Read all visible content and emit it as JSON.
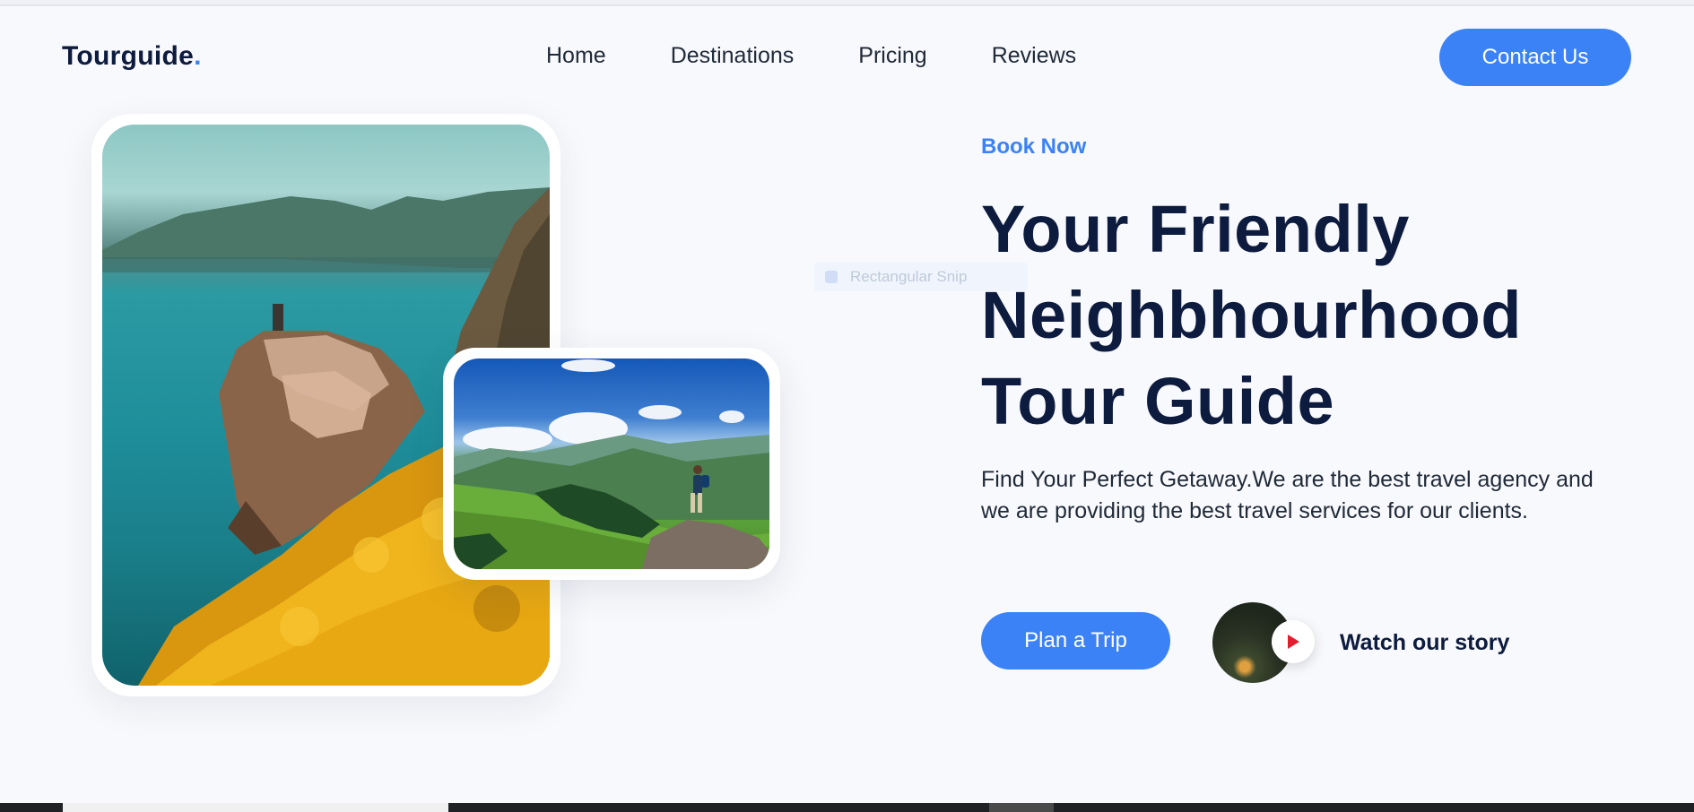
{
  "brand": {
    "name": "Tourguide",
    "dot": "."
  },
  "nav": {
    "items": [
      {
        "label": "Home"
      },
      {
        "label": "Destinations"
      },
      {
        "label": "Pricing"
      },
      {
        "label": "Reviews"
      }
    ],
    "cta_label": "Contact Us"
  },
  "overlay": {
    "snip_label": "Rectangular Snip"
  },
  "hero": {
    "eyebrow": "Book Now",
    "headline_lines": [
      "Your Friendly",
      "Neighbhourhood",
      "Tour Guide"
    ],
    "description": "Find Your Perfect Getaway.We are the best travel agency and we are providing the best travel services for our clients.",
    "primary_cta": "Plan a Trip",
    "story_label": "Watch our story"
  },
  "colors": {
    "accent": "#3b82f6",
    "heading": "#0d1b3e",
    "play_icon": "#e11d2e"
  },
  "icons": {
    "play": "play-icon"
  }
}
